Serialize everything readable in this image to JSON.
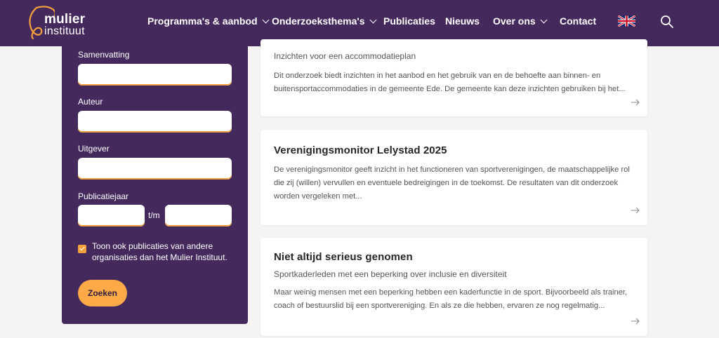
{
  "header": {
    "logo_line1": "mulier",
    "logo_line2": "instituut",
    "nav": [
      {
        "label": "Programma's & aanbod",
        "dropdown": true
      },
      {
        "label": "Onderzoeksthema's",
        "dropdown": true
      },
      {
        "label": "Publicaties",
        "dropdown": false
      },
      {
        "label": "Nieuws",
        "dropdown": false
      },
      {
        "label": "Over ons",
        "dropdown": true
      },
      {
        "label": "Contact",
        "dropdown": false
      }
    ],
    "language_icon": "uk-flag-icon",
    "search_icon": "search-icon"
  },
  "filters": {
    "summary_label": "Samenvatting",
    "summary_value": "",
    "author_label": "Auteur",
    "author_value": "",
    "publisher_label": "Uitgever",
    "publisher_value": "",
    "year_label": "Publicatiejaar",
    "year_from": "",
    "year_to": "",
    "year_separator": "t/m",
    "include_external_label": "Toon ook publicaties van andere organisaties dan het Mulier Instituut.",
    "include_external_checked": true,
    "search_button": "Zoeken"
  },
  "results": [
    {
      "title": "",
      "subtitle": "Inzichten voor een accommodatieplan",
      "description": "Dit onderzoek biedt inzichten in het aanbod en het gebruik van en de behoefte aan binnen- en buitensportaccommodaties in de gemeente Ede. De gemeente kan deze inzichten gebruiken bij het..."
    },
    {
      "title": "Verenigingsmonitor Lelystad 2025",
      "subtitle": "",
      "description": "De verenigingsmonitor geeft inzicht in het functioneren van sportverenigingen, de maatschappelijke rol die zij (willen) vervullen en eventuele bedreigingen in de toekomst. De resultaten van dit onderzoek worden vergeleken met..."
    },
    {
      "title": "Niet altijd serieus genomen",
      "subtitle": "Sportkaderleden met een beperking over inclusie en diversiteit",
      "description": "Maar weinig mensen met een beperking hebben een kaderfunctie in de sport. Bijvoorbeeld als trainer, coach of bestuurslid bij een sportvereniging. En als ze die hebben, ervaren ze nog regelmatig..."
    }
  ],
  "colors": {
    "brand_purple": "#442a5c",
    "accent_orange": "#fcaa47",
    "background": "#f5f4f3"
  }
}
